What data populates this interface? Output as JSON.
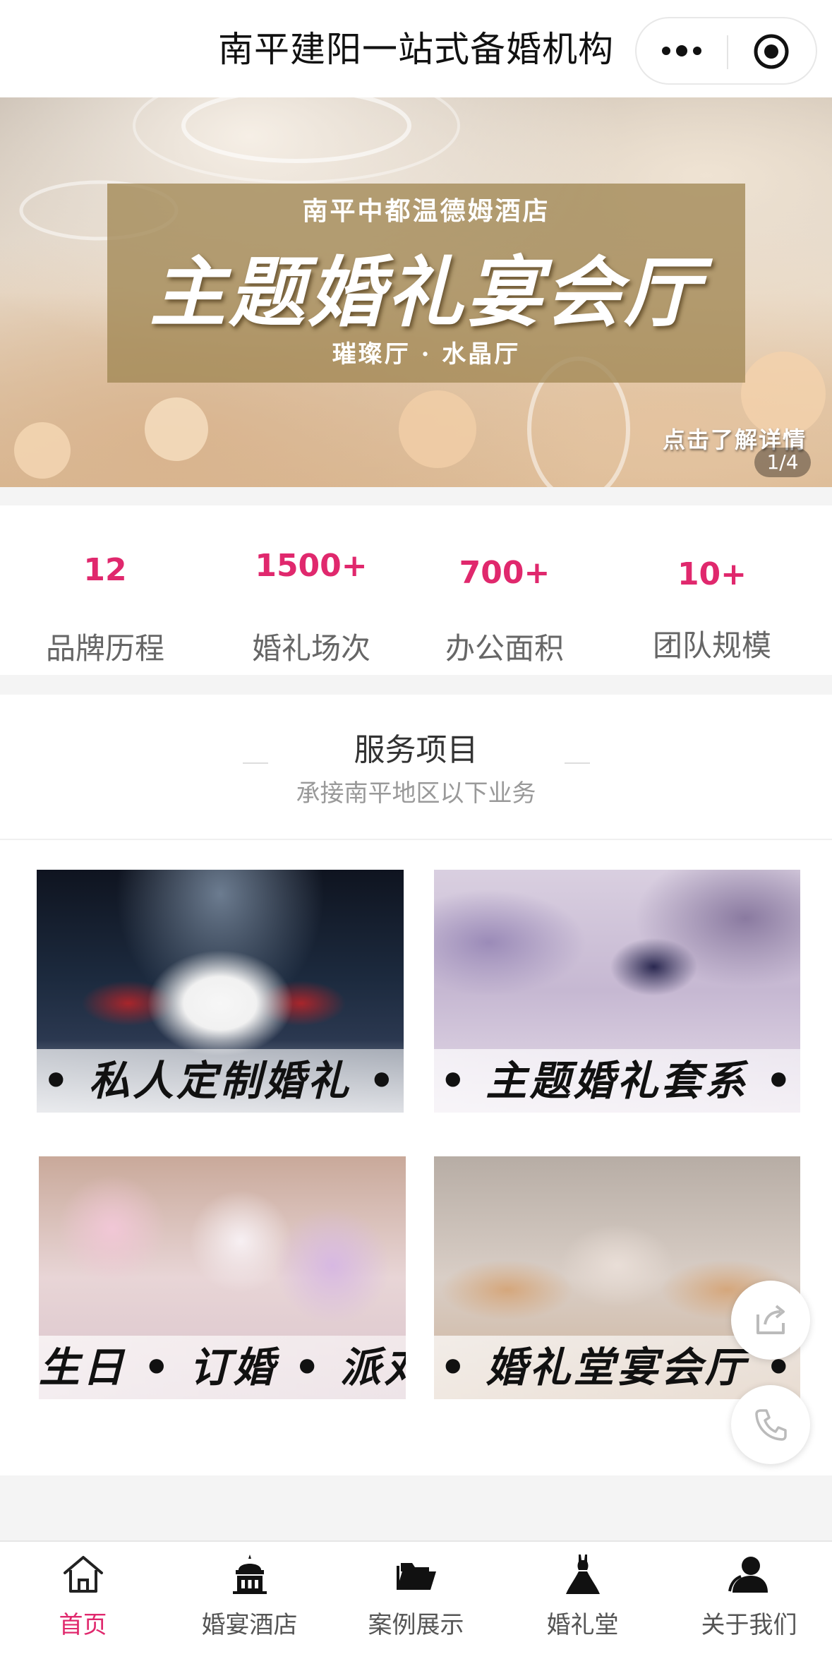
{
  "header": {
    "title": "南平建阳一站式备婚机构",
    "more_icon": "more-dots-icon",
    "close_icon": "target-circle-icon"
  },
  "banner": {
    "subtitle_top": "南平中都温德姆酒店",
    "headline": "主题婚礼宴会厅",
    "subtitle_bottom": "璀璨厅 · 水晶厅",
    "cta": "点击了解详情",
    "pager": "1/4"
  },
  "stats": [
    {
      "value": "12",
      "label": "品牌历程"
    },
    {
      "value": "1500+",
      "label": "婚礼场次"
    },
    {
      "value": "700+",
      "label": "办公面积"
    },
    {
      "value": "10+",
      "label": "团队规模"
    }
  ],
  "services": {
    "title": "服务项目",
    "subtitle": "承接南平地区以下业务",
    "cards": [
      {
        "caption": "• 私人定制婚礼 •"
      },
      {
        "caption": "• 主题婚礼套系 •"
      },
      {
        "caption": "生日 • 订婚 • 派对"
      },
      {
        "caption": "• 婚礼堂宴会厅 •"
      }
    ]
  },
  "fabs": {
    "share_icon": "share-icon",
    "phone_icon": "phone-icon"
  },
  "tabbar": [
    {
      "label": "首页",
      "icon": "home-icon",
      "active": true
    },
    {
      "label": "婚宴酒店",
      "icon": "hotel-building-icon",
      "active": false
    },
    {
      "label": "案例展示",
      "icon": "folder-icon",
      "active": false
    },
    {
      "label": "婚礼堂",
      "icon": "dress-icon",
      "active": false
    },
    {
      "label": "关于我们",
      "icon": "user-icon",
      "active": false
    }
  ],
  "colors": {
    "accent": "#e0286d",
    "text_muted": "#666666"
  }
}
